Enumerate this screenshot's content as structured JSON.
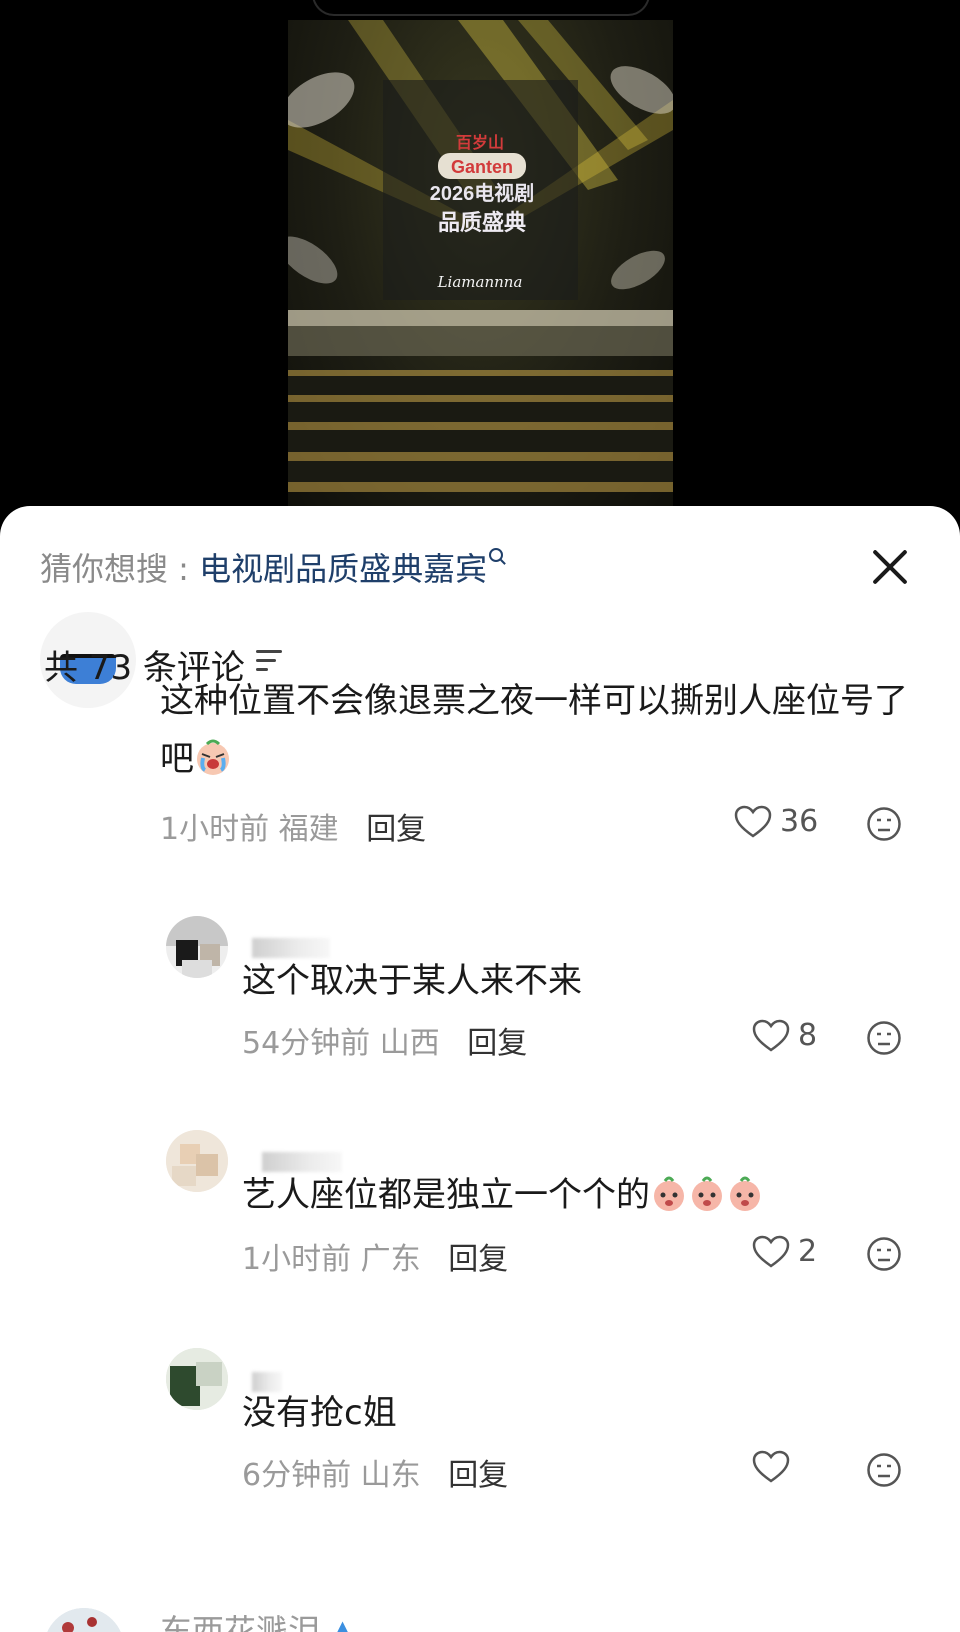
{
  "video": {
    "brand_top": "百岁山",
    "brand_logo": "Ganten",
    "event_line1": "2026电视剧",
    "event_line2": "品质盛典",
    "signature": "Liamannna"
  },
  "search_suggestion": {
    "prefix": "猜你想搜 : ",
    "term": "电视剧品质盛典嘉宾"
  },
  "comments_header": {
    "count_label": "共 73 条评论"
  },
  "comments": [
    {
      "text": "这种位置不会像退票之夜一样可以撕别人座位号了吧",
      "time": "1小时前",
      "location": "福建",
      "reply_label": "回复",
      "likes": "36",
      "emoji": "crying-face-emoji"
    },
    {
      "text": "这个取决于某人来不来",
      "time": "54分钟前",
      "location": "山西",
      "reply_label": "回复",
      "likes": "8"
    },
    {
      "text": "艺人座位都是独立一个个的",
      "time": "1小时前",
      "location": "广东",
      "reply_label": "回复",
      "likes": "2",
      "emoji": "peach-face-emoji"
    },
    {
      "text": "没有抢c姐",
      "time": "6分钟前",
      "location": "山东",
      "reply_label": "回复",
      "likes": ""
    }
  ],
  "next_comment": {
    "name_partial": "东西花溅泪"
  },
  "colors": {
    "sheet_bg": "#ffffff",
    "search_term": "#1f3f6a",
    "meta_grey": "#9a9a9a",
    "avatar_blue": "#3d7fd6"
  }
}
